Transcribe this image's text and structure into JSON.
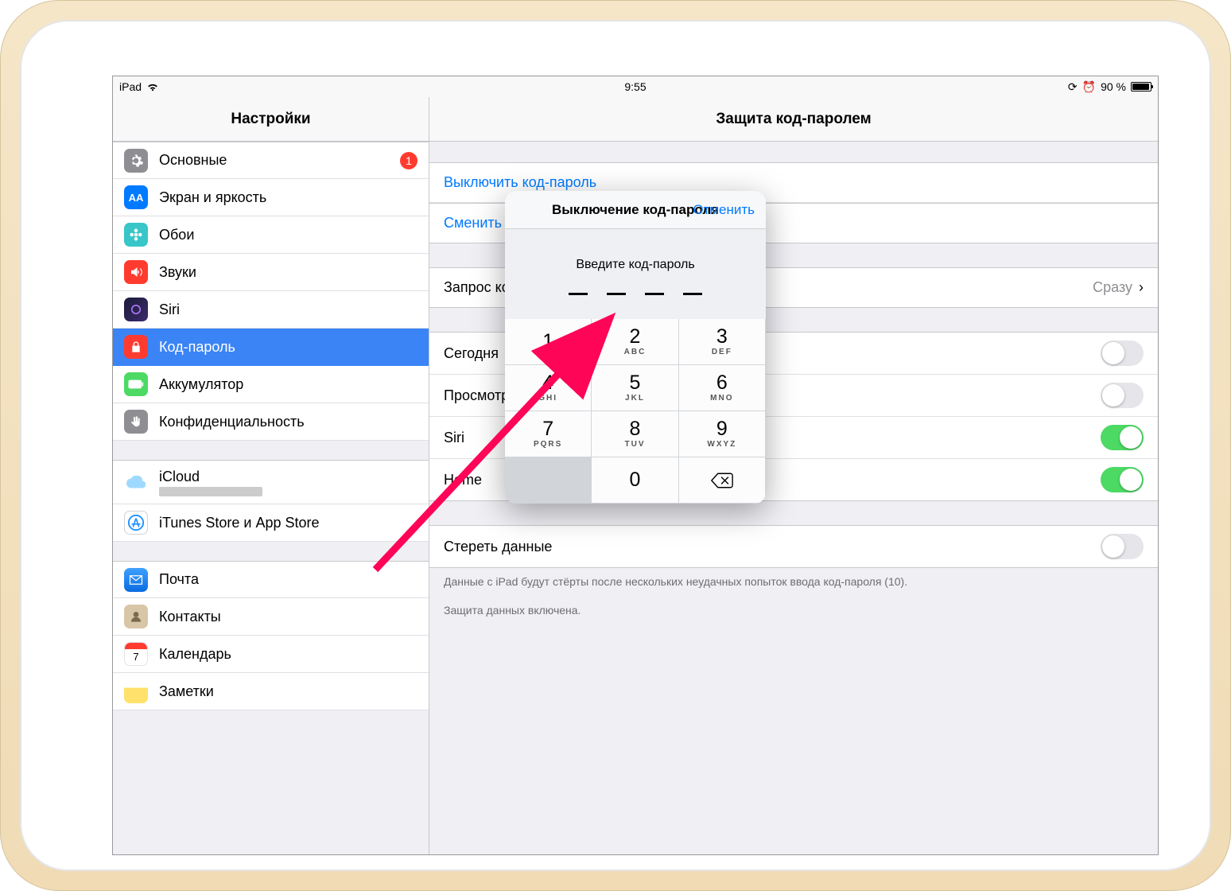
{
  "status": {
    "device": "iPad",
    "time": "9:55",
    "battery_pct": "90 %"
  },
  "sidebar": {
    "title": "Настройки",
    "rows": {
      "general": {
        "label": "Основные",
        "badge": "1"
      },
      "display": {
        "label": "Экран и яркость"
      },
      "wallpaper": {
        "label": "Обои"
      },
      "sounds": {
        "label": "Звуки"
      },
      "siri": {
        "label": "Siri"
      },
      "passcode": {
        "label": "Код-пароль"
      },
      "battery": {
        "label": "Аккумулятор"
      },
      "privacy": {
        "label": "Конфиденциальность"
      },
      "icloud": {
        "label": "iCloud"
      },
      "itunes": {
        "label": "iTunes Store и App Store"
      },
      "mail": {
        "label": "Почта"
      },
      "contacts": {
        "label": "Контакты"
      },
      "calendar": {
        "label": "Календарь"
      },
      "notes": {
        "label": "Заметки"
      }
    }
  },
  "detail": {
    "title": "Защита код-паролем",
    "turn_off": "Выключить код-пароль",
    "change": "Сменить код-пароль",
    "require": {
      "label": "Запрос код-пароля",
      "value": "Сразу"
    },
    "toggles": [
      {
        "label": "Сегодня",
        "on": false
      },
      {
        "label": "Просмотр уведомлений",
        "on": false
      },
      {
        "label": "Siri",
        "on": true
      },
      {
        "label": "Home",
        "on": true
      }
    ],
    "erase": {
      "label": "Стереть данные",
      "on": false
    },
    "erase_note": "Данные с iPad будут стёрты после нескольких неудачных попыток ввода код-пароля (10).",
    "protect_note": "Защита данных включена."
  },
  "popover": {
    "title": "Выключение код-пароля",
    "cancel": "Отменить",
    "prompt": "Введите код-пароль",
    "keys": {
      "1": {
        "num": "1",
        "let": ""
      },
      "2": {
        "num": "2",
        "let": "ABC"
      },
      "3": {
        "num": "3",
        "let": "DEF"
      },
      "4": {
        "num": "4",
        "let": "GHI"
      },
      "5": {
        "num": "5",
        "let": "JKL"
      },
      "6": {
        "num": "6",
        "let": "MNO"
      },
      "7": {
        "num": "7",
        "let": "PQRS"
      },
      "8": {
        "num": "8",
        "let": "TUV"
      },
      "9": {
        "num": "9",
        "let": "WXYZ"
      },
      "0": {
        "num": "0",
        "let": ""
      }
    }
  }
}
